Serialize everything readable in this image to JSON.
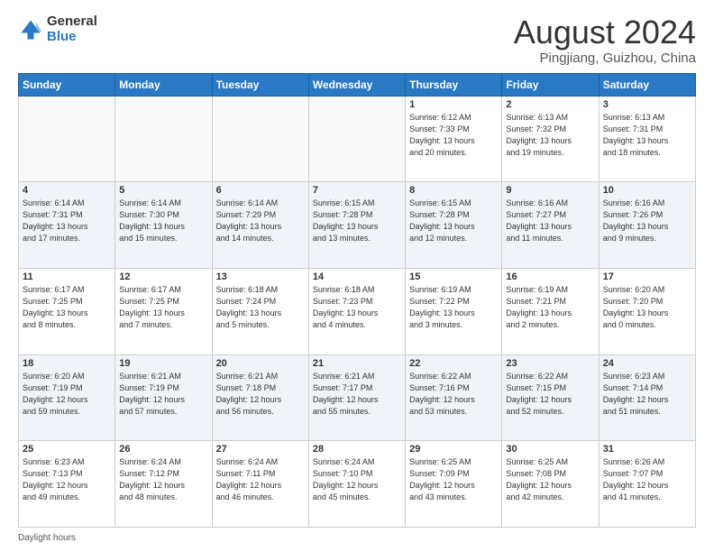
{
  "header": {
    "logo_general": "General",
    "logo_blue": "Blue",
    "month_title": "August 2024",
    "location": "Pingjiang, Guizhou, China"
  },
  "weekdays": [
    "Sunday",
    "Monday",
    "Tuesday",
    "Wednesday",
    "Thursday",
    "Friday",
    "Saturday"
  ],
  "weeks": [
    [
      {
        "day": "",
        "info": ""
      },
      {
        "day": "",
        "info": ""
      },
      {
        "day": "",
        "info": ""
      },
      {
        "day": "",
        "info": ""
      },
      {
        "day": "1",
        "info": "Sunrise: 6:12 AM\nSunset: 7:33 PM\nDaylight: 13 hours\nand 20 minutes."
      },
      {
        "day": "2",
        "info": "Sunrise: 6:13 AM\nSunset: 7:32 PM\nDaylight: 13 hours\nand 19 minutes."
      },
      {
        "day": "3",
        "info": "Sunrise: 6:13 AM\nSunset: 7:31 PM\nDaylight: 13 hours\nand 18 minutes."
      }
    ],
    [
      {
        "day": "4",
        "info": "Sunrise: 6:14 AM\nSunset: 7:31 PM\nDaylight: 13 hours\nand 17 minutes."
      },
      {
        "day": "5",
        "info": "Sunrise: 6:14 AM\nSunset: 7:30 PM\nDaylight: 13 hours\nand 15 minutes."
      },
      {
        "day": "6",
        "info": "Sunrise: 6:14 AM\nSunset: 7:29 PM\nDaylight: 13 hours\nand 14 minutes."
      },
      {
        "day": "7",
        "info": "Sunrise: 6:15 AM\nSunset: 7:28 PM\nDaylight: 13 hours\nand 13 minutes."
      },
      {
        "day": "8",
        "info": "Sunrise: 6:15 AM\nSunset: 7:28 PM\nDaylight: 13 hours\nand 12 minutes."
      },
      {
        "day": "9",
        "info": "Sunrise: 6:16 AM\nSunset: 7:27 PM\nDaylight: 13 hours\nand 11 minutes."
      },
      {
        "day": "10",
        "info": "Sunrise: 6:16 AM\nSunset: 7:26 PM\nDaylight: 13 hours\nand 9 minutes."
      }
    ],
    [
      {
        "day": "11",
        "info": "Sunrise: 6:17 AM\nSunset: 7:25 PM\nDaylight: 13 hours\nand 8 minutes."
      },
      {
        "day": "12",
        "info": "Sunrise: 6:17 AM\nSunset: 7:25 PM\nDaylight: 13 hours\nand 7 minutes."
      },
      {
        "day": "13",
        "info": "Sunrise: 6:18 AM\nSunset: 7:24 PM\nDaylight: 13 hours\nand 5 minutes."
      },
      {
        "day": "14",
        "info": "Sunrise: 6:18 AM\nSunset: 7:23 PM\nDaylight: 13 hours\nand 4 minutes."
      },
      {
        "day": "15",
        "info": "Sunrise: 6:19 AM\nSunset: 7:22 PM\nDaylight: 13 hours\nand 3 minutes."
      },
      {
        "day": "16",
        "info": "Sunrise: 6:19 AM\nSunset: 7:21 PM\nDaylight: 13 hours\nand 2 minutes."
      },
      {
        "day": "17",
        "info": "Sunrise: 6:20 AM\nSunset: 7:20 PM\nDaylight: 13 hours\nand 0 minutes."
      }
    ],
    [
      {
        "day": "18",
        "info": "Sunrise: 6:20 AM\nSunset: 7:19 PM\nDaylight: 12 hours\nand 59 minutes."
      },
      {
        "day": "19",
        "info": "Sunrise: 6:21 AM\nSunset: 7:19 PM\nDaylight: 12 hours\nand 57 minutes."
      },
      {
        "day": "20",
        "info": "Sunrise: 6:21 AM\nSunset: 7:18 PM\nDaylight: 12 hours\nand 56 minutes."
      },
      {
        "day": "21",
        "info": "Sunrise: 6:21 AM\nSunset: 7:17 PM\nDaylight: 12 hours\nand 55 minutes."
      },
      {
        "day": "22",
        "info": "Sunrise: 6:22 AM\nSunset: 7:16 PM\nDaylight: 12 hours\nand 53 minutes."
      },
      {
        "day": "23",
        "info": "Sunrise: 6:22 AM\nSunset: 7:15 PM\nDaylight: 12 hours\nand 52 minutes."
      },
      {
        "day": "24",
        "info": "Sunrise: 6:23 AM\nSunset: 7:14 PM\nDaylight: 12 hours\nand 51 minutes."
      }
    ],
    [
      {
        "day": "25",
        "info": "Sunrise: 6:23 AM\nSunset: 7:13 PM\nDaylight: 12 hours\nand 49 minutes."
      },
      {
        "day": "26",
        "info": "Sunrise: 6:24 AM\nSunset: 7:12 PM\nDaylight: 12 hours\nand 48 minutes."
      },
      {
        "day": "27",
        "info": "Sunrise: 6:24 AM\nSunset: 7:11 PM\nDaylight: 12 hours\nand 46 minutes."
      },
      {
        "day": "28",
        "info": "Sunrise: 6:24 AM\nSunset: 7:10 PM\nDaylight: 12 hours\nand 45 minutes."
      },
      {
        "day": "29",
        "info": "Sunrise: 6:25 AM\nSunset: 7:09 PM\nDaylight: 12 hours\nand 43 minutes."
      },
      {
        "day": "30",
        "info": "Sunrise: 6:25 AM\nSunset: 7:08 PM\nDaylight: 12 hours\nand 42 minutes."
      },
      {
        "day": "31",
        "info": "Sunrise: 6:26 AM\nSunset: 7:07 PM\nDaylight: 12 hours\nand 41 minutes."
      }
    ]
  ],
  "footer": {
    "daylight_label": "Daylight hours"
  }
}
